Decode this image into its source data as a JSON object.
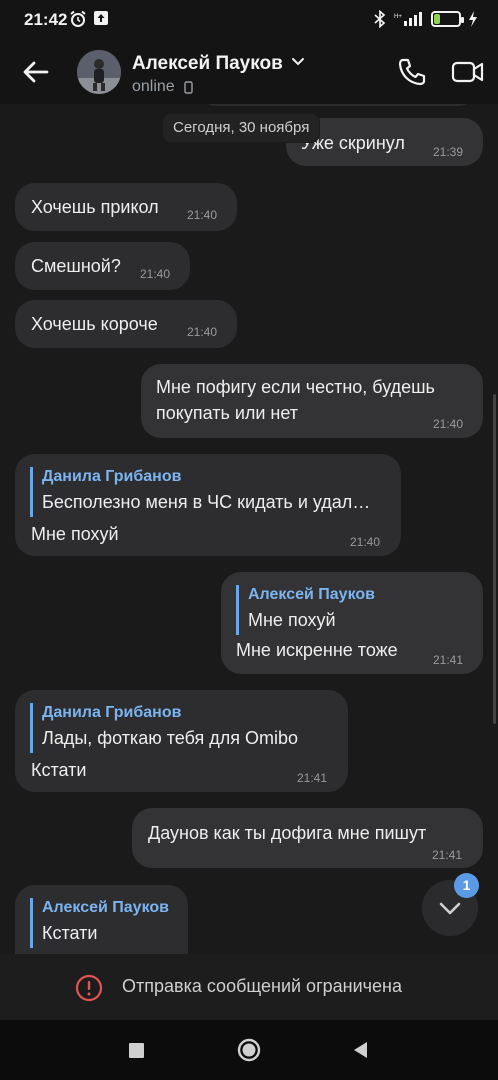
{
  "status_bar": {
    "time": "21:42",
    "battery": "22",
    "battery_level": 0.22,
    "icons": [
      "alarm-icon",
      "upload-icon",
      "bluetooth-icon",
      "signal-icon",
      "battery-icon",
      "charging-icon"
    ]
  },
  "header": {
    "contact_name": "Алексей Пауков",
    "status": "online"
  },
  "chat": {
    "date_separator": "Сегодня, 30 ноября",
    "messages": [
      {
        "text": "Уже скринул",
        "time": "21:39",
        "dir": "out"
      },
      {
        "text": "Хочешь прикол",
        "time": "21:40",
        "dir": "in"
      },
      {
        "text": "Смешной?",
        "time": "21:40",
        "dir": "in"
      },
      {
        "text": "Хочешь короче",
        "time": "21:40",
        "dir": "in"
      },
      {
        "lines": [
          "Мне пофигу если честно, будешь",
          "покупать или нет"
        ],
        "time": "21:40",
        "dir": "out"
      },
      {
        "reply_name": "Данила Грибанов",
        "reply_text": "Бесполезно меня в ЧС кидать и удал…",
        "text": "Мне похуй",
        "time": "21:40",
        "dir": "in"
      },
      {
        "reply_name": "Алексей Пауков",
        "reply_text": "Мне похуй",
        "text": "Мне искренне тоже",
        "time": "21:41",
        "dir": "out"
      },
      {
        "reply_name": "Данила Грибанов",
        "reply_text": "Лады, фоткаю тебя для Omibo",
        "text": "Кстати",
        "time": "21:41",
        "dir": "in"
      },
      {
        "text": "Даунов как ты дофига мне пишут",
        "time": "21:41",
        "dir": "out"
      },
      {
        "reply_name": "Алексей Пауков",
        "reply_text": "Кстати",
        "dir": "in"
      }
    ],
    "unread_count": "1"
  },
  "restriction": {
    "text": "Отправка сообщений ограничена"
  },
  "colors": {
    "background": "#1a1a1a",
    "bubble": "#2d2d2f",
    "accent": "#6aa6e8",
    "warning": "#e05555",
    "badge": "#5b9be6"
  }
}
